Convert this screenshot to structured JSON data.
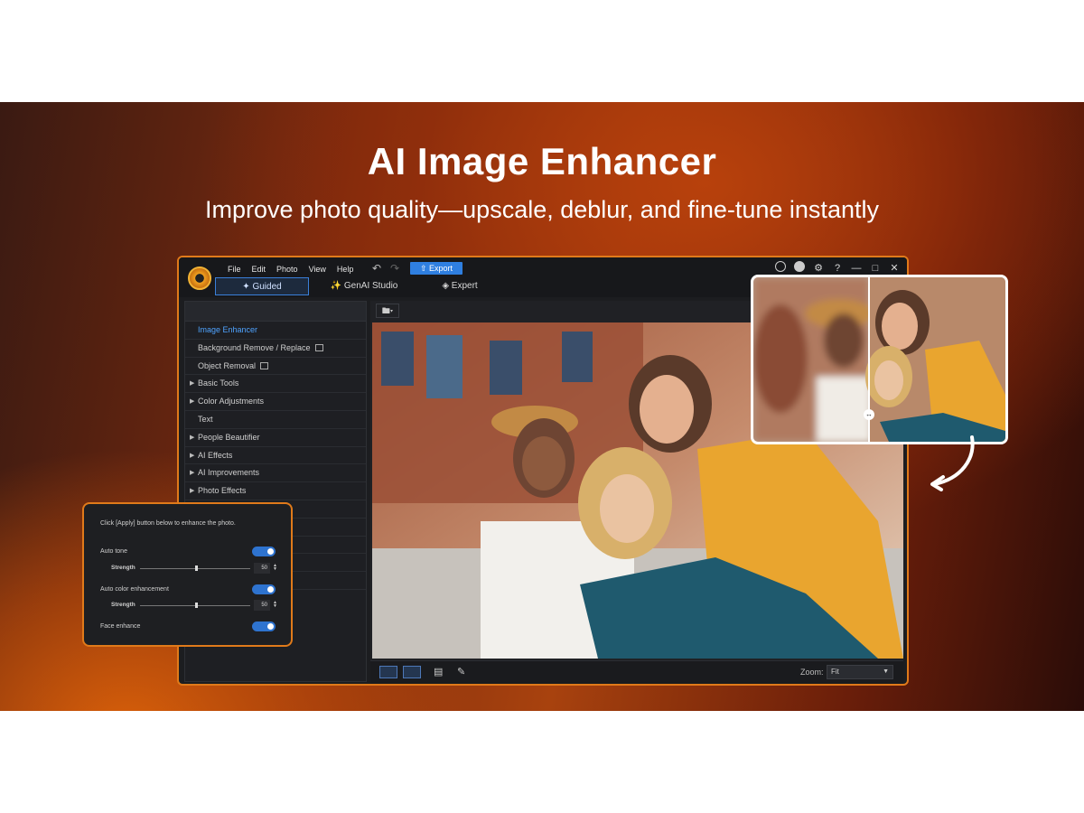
{
  "hero": {
    "title": "AI Image Enhancer",
    "subtitle": "Improve photo quality—upscale, deblur, and fine-tune instantly"
  },
  "menu": [
    "File",
    "Edit",
    "Photo",
    "View",
    "Help"
  ],
  "toolbar": {
    "export_label": "Export"
  },
  "modes": {
    "guided": "Guided",
    "genai": "GenAI Studio",
    "expert": "Expert"
  },
  "sidebar": {
    "items": [
      {
        "label": "Image Enhancer",
        "active": true
      },
      {
        "label": "Background Remove / Replace"
      },
      {
        "label": "Object Removal"
      },
      {
        "label": "Basic Tools"
      },
      {
        "label": "Color Adjustments"
      },
      {
        "label": "Text"
      },
      {
        "label": "People Beautifier"
      },
      {
        "label": "AI Effects"
      },
      {
        "label": "AI Improvements"
      },
      {
        "label": "Photo Effects"
      }
    ]
  },
  "enhance_panel": {
    "note": "Click [Apply] button below to enhance the photo.",
    "auto_tone": "Auto tone",
    "strength_label": "Strength",
    "auto_tone_strength": "50",
    "auto_color": "Auto color enhancement",
    "auto_color_strength": "50",
    "face_enhance": "Face enhance"
  },
  "zoom": {
    "label": "Zoom:",
    "value": "Fit"
  },
  "icons": [
    "logo-icon",
    "undo-icon",
    "redo-icon",
    "upload-icon",
    "account-icon",
    "notification-icon",
    "settings-icon",
    "help-icon",
    "minimize-icon",
    "maximize-icon",
    "close-icon",
    "wand-icon",
    "sparkle-icon",
    "layers-icon",
    "folder-icon",
    "single-view-icon",
    "compare-view-icon",
    "histogram-icon",
    "brush-icon",
    "chevron-down-icon",
    "curved-arrow-icon"
  ],
  "colors": {
    "accent": "#e07a1a",
    "active_blue": "#2f7fe0",
    "sidebar_active": "#4fa3ff"
  }
}
